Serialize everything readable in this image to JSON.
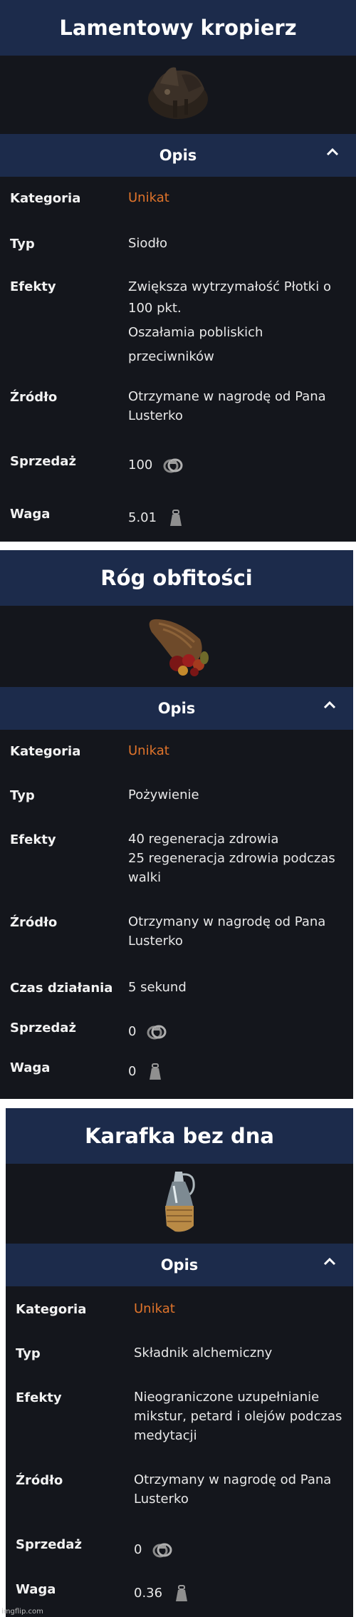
{
  "items": [
    {
      "title": "Lamentowy kropierz",
      "opis": "Opis",
      "icon": "saddle-icon",
      "rows": [
        {
          "label": "Kategoria",
          "value": [
            "Unikat"
          ],
          "accent": true
        },
        {
          "label": "Typ",
          "value": [
            "Siodło"
          ]
        },
        {
          "label": "Efekty",
          "value": [
            "Zwiększa wytrzymałość Płotki o",
            "100 pkt.",
            "Oszałamia pobliskich",
            "przeciwników"
          ]
        },
        {
          "label": "Źródło",
          "value": [
            "Otrzymane w nagrodę od Pana",
            "Lusterko"
          ]
        },
        {
          "label": "Sprzedaż",
          "value": [
            "100"
          ],
          "icon": "crowns-icon"
        },
        {
          "label": "Waga",
          "value": [
            "5.01"
          ],
          "icon": "weight-icon"
        }
      ]
    },
    {
      "title": "Róg obfitości",
      "opis": "Opis",
      "icon": "cornucopia-icon",
      "rows": [
        {
          "label": "Kategoria",
          "value": [
            "Unikat"
          ],
          "accent": true
        },
        {
          "label": "Typ",
          "value": [
            "Pożywienie"
          ]
        },
        {
          "label": "Efekty",
          "value": [
            "40 regeneracja zdrowia",
            "25 regeneracja zdrowia podczas",
            "walki"
          ]
        },
        {
          "label": "Źródło",
          "value": [
            "Otrzymany w nagrodę od Pana",
            "Lusterko"
          ]
        },
        {
          "label": "Czas działania",
          "value": [
            "5 sekund"
          ]
        },
        {
          "label": "Sprzedaż",
          "value": [
            "0"
          ],
          "icon": "crowns-icon"
        },
        {
          "label": "Waga",
          "value": [
            "0"
          ],
          "icon": "weight-icon"
        }
      ]
    },
    {
      "title": "Karafka bez dna",
      "opis": "Opis",
      "icon": "carafe-icon",
      "rows": [
        {
          "label": "Kategoria",
          "value": [
            "Unikat"
          ],
          "accent": true
        },
        {
          "label": "Typ",
          "value": [
            "Składnik alchemiczny"
          ]
        },
        {
          "label": "Efekty",
          "value": [
            "Nieograniczone uzupełnianie",
            "mikstur, petard i olejów podczas",
            "medytacji"
          ]
        },
        {
          "label": "Źródło",
          "value": [
            "Otrzymany w nagrodę od Pana",
            "Lusterko"
          ]
        },
        {
          "label": "Sprzedaż",
          "value": [
            "0"
          ],
          "icon": "crowns-icon"
        },
        {
          "label": "Waga",
          "value": [
            "0.36"
          ],
          "icon": "weight-icon"
        }
      ]
    }
  ],
  "colors": {
    "header": "#1c2b4b",
    "card": "#14161c",
    "accent": "#e0742b"
  },
  "footer": "imgflip.com"
}
